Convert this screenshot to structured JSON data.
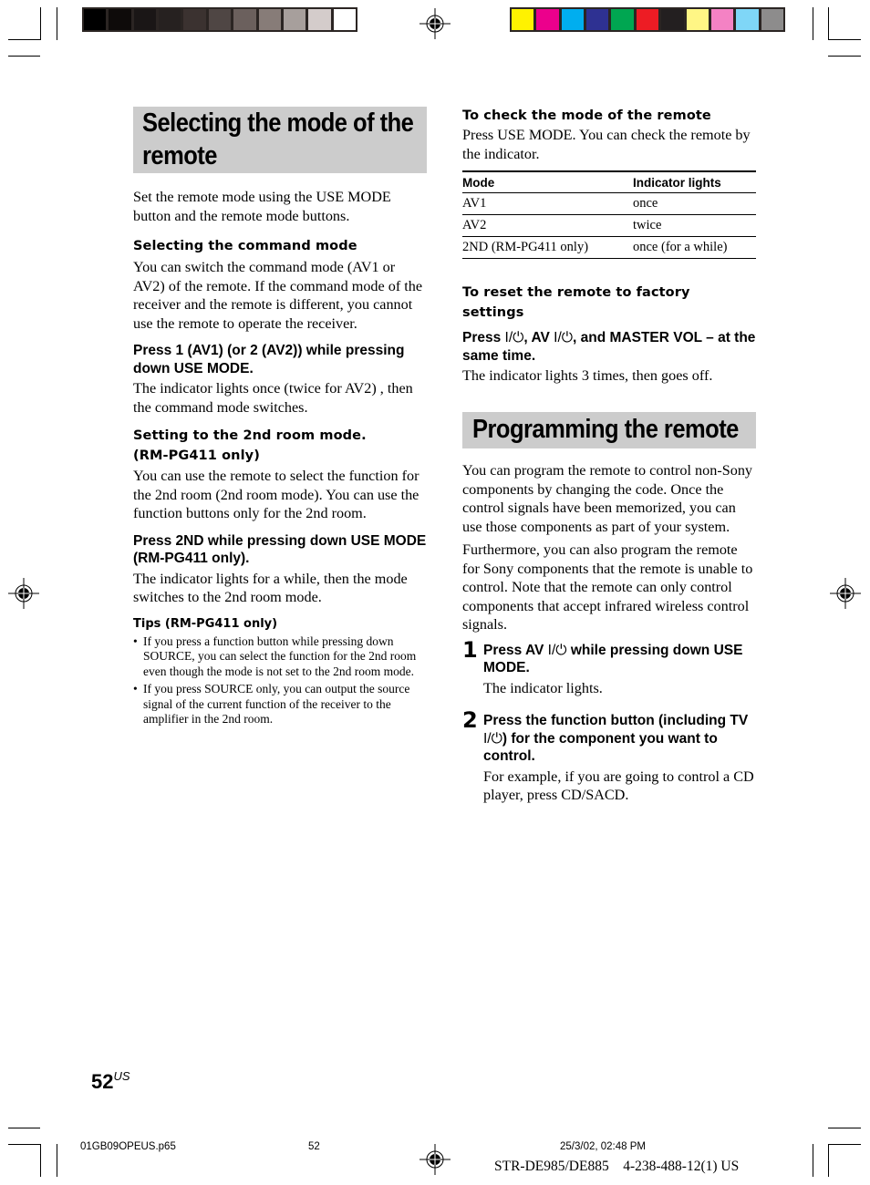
{
  "print_marks": {
    "grayscale_swatches": [
      "#000000",
      "#0e0b0a",
      "#1a1616",
      "#262120",
      "#3b3230",
      "#4f4644",
      "#6b605d",
      "#877c78",
      "#a79f9c",
      "#d4cccb",
      "#ffffff"
    ],
    "color_swatches": [
      "#fff200",
      "#ec008c",
      "#00aeef",
      "#2e3192",
      "#00a651",
      "#ed1c24",
      "#231f20",
      "#fff685",
      "#f482c4",
      "#7fd6f7",
      "#8d8c8c"
    ]
  },
  "left": {
    "title": "Selecting the mode of the remote",
    "title_line1": "Selecting the mode of the",
    "title_line2": "remote",
    "intro": "Set the remote mode using the USE MODE button and the remote mode buttons.",
    "command_mode": {
      "heading": "Selecting the command mode",
      "body": "You can switch the command mode (AV1 or AV2) of the remote. If the command mode of the receiver and the remote is different, you cannot use the remote to operate the receiver.",
      "instruction": "Press 1 (AV1) (or 2 (AV2)) while pressing down USE MODE.",
      "result": "The indicator lights once (twice for AV2) , then the command mode switches."
    },
    "room_mode": {
      "heading_line1": "Setting to the 2nd room mode.",
      "heading_line2": "(RM-PG411 only)",
      "body": "You can use the remote to select the function for the 2nd room (2nd room mode). You can use the function buttons only for the 2nd room.",
      "instruction": "Press 2ND while pressing down USE MODE (RM-PG411 only).",
      "result": "The indicator lights for a while, then the mode switches to the 2nd room mode."
    },
    "tips": {
      "heading": "Tips (RM-PG411 only)",
      "items": [
        "If you press a function button while pressing down SOURCE, you can select the function for the 2nd room even though the mode is not set to the 2nd room mode.",
        "If you press SOURCE only, you can output the source signal of the current function of the receiver to the amplifier in the 2nd room."
      ]
    }
  },
  "right": {
    "check_mode": {
      "heading": "To check the mode of the remote",
      "body": "Press USE MODE. You can check the remote by the indicator.",
      "table": {
        "headers": [
          "Mode",
          "Indicator lights"
        ],
        "rows": [
          [
            "AV1",
            "once"
          ],
          [
            "AV2",
            "twice"
          ],
          [
            "2ND (RM-PG411 only)",
            "once (for a while)"
          ]
        ]
      }
    },
    "reset": {
      "heading": "To reset the remote to factory settings",
      "instruction_parts": [
        "Press ",
        "I/⏻",
        ", AV ",
        "I/⏻",
        ", and MASTER VOL – at the same time."
      ],
      "result": "The indicator lights 3 times, then goes off."
    },
    "programming": {
      "title": "Programming the remote",
      "para1": "You can program the remote to control non-Sony components by changing the code. Once the control signals have been memorized, you can use those components as part of your system.",
      "para2": "Furthermore, you can also program the remote for Sony components that the remote is unable to control. Note that the remote can only control components that accept infrared wireless control signals.",
      "steps": [
        {
          "number": "1",
          "instruction_a": "Press AV ",
          "power_symbol": "I/⏻",
          "instruction_b": " while pressing down USE MODE.",
          "result": "The indicator lights."
        },
        {
          "number": "2",
          "instruction_a": "Press the function button (including TV ",
          "power_symbol": "I/⏻",
          "instruction_b": ") for the component you want to control.",
          "result": "For example, if you are going to control a CD player, press CD/SACD."
        }
      ]
    }
  },
  "footer": {
    "page_number": "52",
    "page_suffix": "US",
    "file_name": "01GB09OPEUS.p65",
    "slug_page": "52",
    "date_time": "25/3/02, 02:48 PM",
    "model_code": "STR-DE985/DE885    4-238-488-12(1) US"
  }
}
